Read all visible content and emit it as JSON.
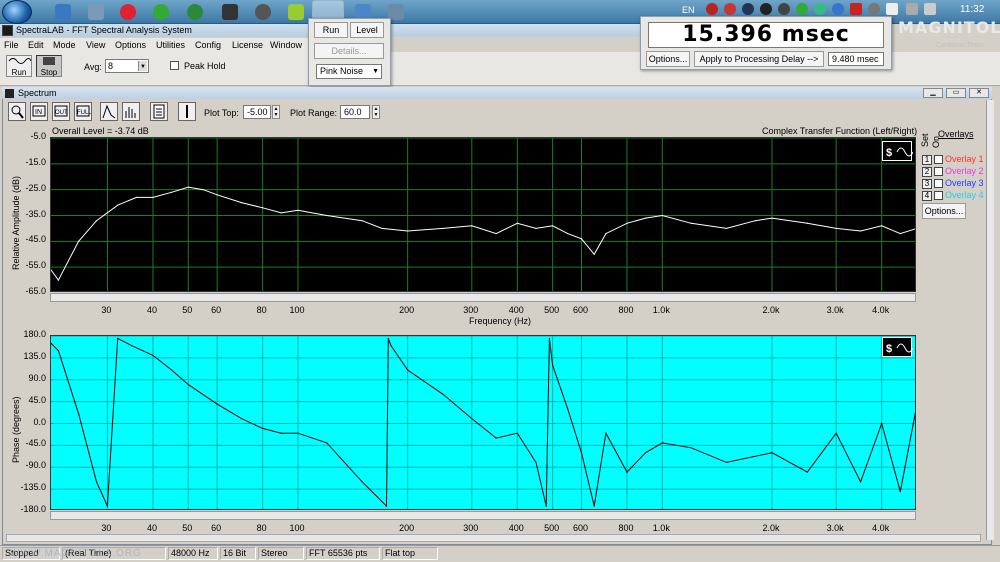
{
  "app": {
    "title": "SpectraLAB - FFT Spectral Analysis System"
  },
  "menu": [
    "File",
    "Edit",
    "Mode",
    "View",
    "Options",
    "Utilities",
    "Config",
    "License",
    "Window"
  ],
  "toolbar": {
    "run_label": "Run",
    "stop_label": "Stop",
    "avg_label": "Avg:",
    "avg_value": "8",
    "peak_hold_label": "Peak Hold"
  },
  "popup": {
    "run": "Run",
    "level": "Level",
    "details": "Details...",
    "generator": "Pink Noise"
  },
  "delay": {
    "value": "15.396 msec",
    "options": "Options...",
    "apply": "Apply to Processing Delay -->",
    "delay_value": "9.480 msec"
  },
  "tray": {
    "lang": "EN",
    "time": "11:32"
  },
  "logo": {
    "main": "MAGNITOLA",
    "sub": "Cardamo Team"
  },
  "spectrum": {
    "title": "Spectrum",
    "plot_top_label": "Plot Top:",
    "plot_top_value": "-5.00",
    "plot_range_label": "Plot Range:",
    "plot_range_value": "60.0",
    "overall_level": "Overall Level = -3.74 dB",
    "mode_label": "Complex Transfer Function (Left/Right)",
    "overlays_label": "Overlays",
    "set_label": "Set",
    "on_label": "On",
    "overlays": [
      {
        "n": "1",
        "name": "Overlay 1",
        "color": "#ff3030"
      },
      {
        "n": "2",
        "name": "Overlay 2",
        "color": "#e040e0"
      },
      {
        "n": "3",
        "name": "Overlay 3",
        "color": "#2040ff"
      },
      {
        "n": "4",
        "name": "Overlay 4",
        "color": "#20d0e0"
      }
    ],
    "overlay_options": "Options...",
    "amp_ylabel": "Relative Amplitude (dB)",
    "amp_yticks": [
      "-5.0",
      "-15.0",
      "-25.0",
      "-35.0",
      "-45.0",
      "-55.0",
      "-65.0"
    ],
    "phase_ylabel": "Phase (degrees)",
    "phase_yticks": [
      "180.0",
      "135.0",
      "90.0",
      "45.0",
      "0.0",
      "-45.0",
      "-90.0",
      "-135.0",
      "-180.0"
    ],
    "xlabel": "Frequency (Hz)",
    "xticks": [
      "30",
      "40",
      "50",
      "60",
      "80",
      "100",
      "200",
      "300",
      "400",
      "500",
      "600",
      "800",
      "1.0k",
      "2.0k",
      "3.0k",
      "4.0k"
    ],
    "colors": {
      "amp_bg": "#000000",
      "amp_trace": "#ffffff",
      "amp_grid": "#1e7d1e",
      "phase_bg": "#00ffff",
      "phase_trace": "#000000"
    }
  },
  "status": {
    "state": "Stopped",
    "mode": "(Real Time)",
    "rate": "48000 Hz",
    "bits": "16 Bit",
    "channels": "Stereo",
    "fft": "FFT 65536 pts",
    "window": "Flat top"
  },
  "watermark": "WWW.MAGNITOLA.ORG",
  "chart_data": [
    {
      "type": "line",
      "xlabel": "Frequency (Hz)",
      "ylabel": "Relative Amplitude (dB)",
      "ylim": [
        -65,
        -5
      ],
      "xscale": "log",
      "series": [
        {
          "x": [
            20,
            22,
            25,
            28,
            32,
            36,
            40,
            45,
            50,
            55,
            60,
            70,
            80,
            90,
            100,
            120,
            150,
            170,
            200,
            250,
            300,
            350,
            400,
            450,
            500,
            550,
            600,
            650,
            700,
            800,
            900,
            1000,
            1200,
            1500,
            1800,
            2000,
            2500,
            3000,
            3500,
            4000,
            4500,
            5000
          ],
          "y": [
            -52,
            -60,
            -45,
            -37,
            -31,
            -28,
            -28,
            -26,
            -24,
            -25,
            -27,
            -30,
            -32,
            -34,
            -33,
            -35,
            -37,
            -40,
            -41,
            -40,
            -39,
            -42,
            -38,
            -40,
            -39,
            -42,
            -44,
            -50,
            -42,
            -38,
            -36,
            -35,
            -38,
            -40,
            -37,
            -36,
            -38,
            -40,
            -41,
            -39,
            -42,
            -40
          ]
        }
      ]
    },
    {
      "type": "line",
      "xlabel": "Frequency (Hz)",
      "ylabel": "Phase (degrees)",
      "ylim": [
        -180,
        180
      ],
      "xscale": "log",
      "series": [
        {
          "x": [
            20,
            21,
            22,
            25,
            28,
            30,
            32,
            35,
            40,
            45,
            50,
            60,
            70,
            80,
            90,
            100,
            120,
            150,
            175,
            177,
            180,
            200,
            250,
            300,
            350,
            400,
            450,
            480,
            490,
            500,
            550,
            600,
            650,
            700,
            800,
            900,
            1000,
            1200,
            1500,
            2000,
            2500,
            3000,
            3500,
            4000,
            4500,
            5000
          ],
          "y": [
            170,
            165,
            150,
            20,
            -120,
            -170,
            175,
            160,
            140,
            110,
            80,
            40,
            10,
            -10,
            -20,
            -20,
            -40,
            -120,
            -170,
            175,
            160,
            110,
            60,
            10,
            -30,
            -20,
            -80,
            -170,
            175,
            120,
            30,
            -60,
            -170,
            -20,
            -100,
            -60,
            -40,
            -50,
            -80,
            -60,
            -100,
            -20,
            -120,
            0,
            -140,
            40
          ]
        }
      ]
    }
  ]
}
